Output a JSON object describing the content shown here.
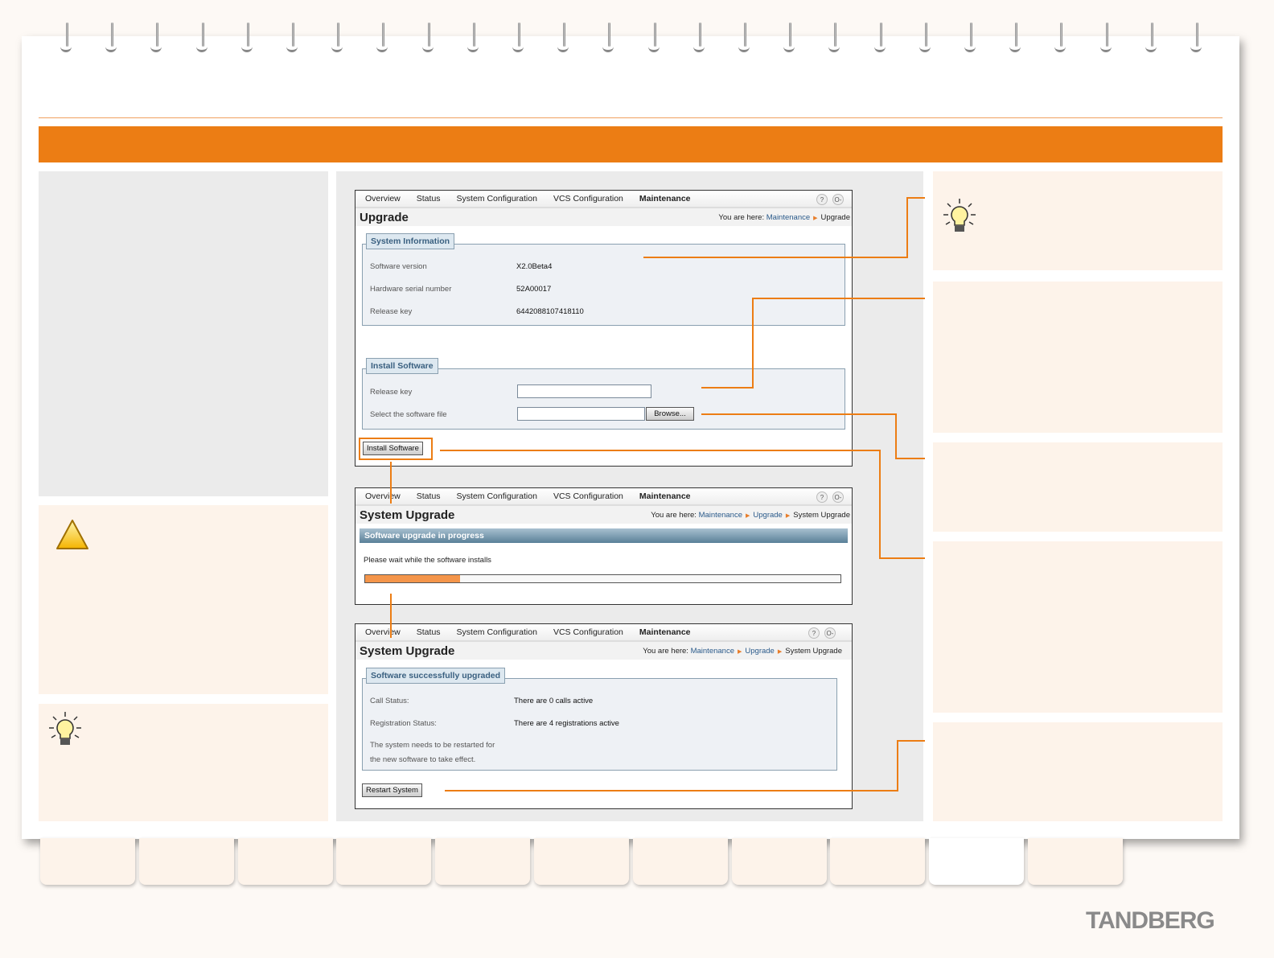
{
  "nav": {
    "items": [
      "Overview",
      "Status",
      "System Configuration",
      "VCS Configuration",
      "Maintenance"
    ],
    "active": "Maintenance",
    "help_icon": "?",
    "logout_icon": "O-"
  },
  "screen1": {
    "title": "Upgrade",
    "breadcrumb_prefix": "You are here:",
    "breadcrumb": [
      "Maintenance",
      "Upgrade"
    ],
    "system_info": {
      "legend": "System Information",
      "rows": [
        {
          "label": "Software version",
          "value": "X2.0Beta4"
        },
        {
          "label": "Hardware serial number",
          "value": "52A00017"
        },
        {
          "label": "Release key",
          "value": "6442088107418110"
        }
      ]
    },
    "install": {
      "legend": "Install Software",
      "release_key_label": "Release key",
      "release_key_value": "",
      "file_label": "Select the software file",
      "file_value": "",
      "browse_label": "Browse..."
    },
    "install_button": "Install Software"
  },
  "screen2": {
    "title": "System Upgrade",
    "breadcrumb_prefix": "You are here:",
    "breadcrumb": [
      "Maintenance",
      "Upgrade",
      "System Upgrade"
    ],
    "banner": "Software upgrade in progress",
    "message": "Please wait while the software installs",
    "progress_percent": 20
  },
  "screen3": {
    "title": "System Upgrade",
    "breadcrumb_prefix": "You are here:",
    "breadcrumb": [
      "Maintenance",
      "Upgrade",
      "System Upgrade"
    ],
    "legend": "Software successfully upgraded",
    "rows": [
      {
        "label": "Call Status:",
        "value": "There are 0 calls active"
      },
      {
        "label": "Registration Status:",
        "value": "There are 4 registrations active"
      }
    ],
    "note_line1": "The system needs to be restarted for",
    "note_line2": "the new software to take effect.",
    "restart_button": "Restart System"
  },
  "brand": "TANDBERG",
  "colors": {
    "accent": "#ec7d14",
    "panel": "#ebebeb",
    "note": "#fdf3ea"
  }
}
